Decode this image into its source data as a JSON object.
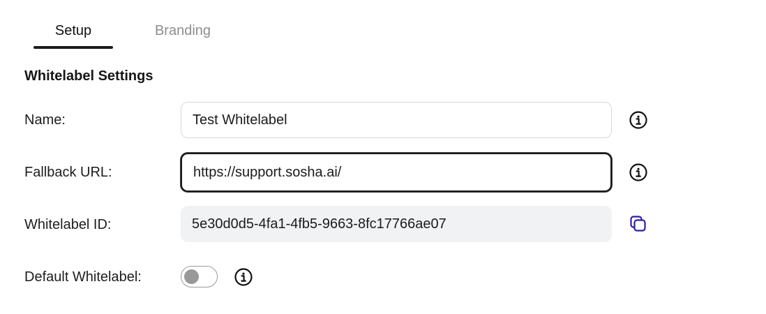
{
  "tabs": [
    {
      "label": "Setup",
      "active": true
    },
    {
      "label": "Branding",
      "active": false
    }
  ],
  "section": {
    "title": "Whitelabel Settings"
  },
  "form": {
    "name": {
      "label": "Name:",
      "value": "Test Whitelabel"
    },
    "fallback_url": {
      "label": "Fallback URL:",
      "value": "https://support.sosha.ai/"
    },
    "whitelabel_id": {
      "label": "Whitelabel ID:",
      "value": "5e30d0d5-4fa1-4fb5-9663-8fc17766ae07"
    },
    "default_whitelabel": {
      "label": "Default Whitelabel:",
      "enabled": false
    }
  },
  "icons": {
    "info": "info-circle-icon",
    "copy": "copy-icon"
  },
  "colors": {
    "active_tab": "#111111",
    "inactive_tab": "#8d8d8d",
    "copy_icon": "#2b1fa8",
    "readonly_bg": "#f1f2f4",
    "toggle_off_knob": "#999999"
  }
}
